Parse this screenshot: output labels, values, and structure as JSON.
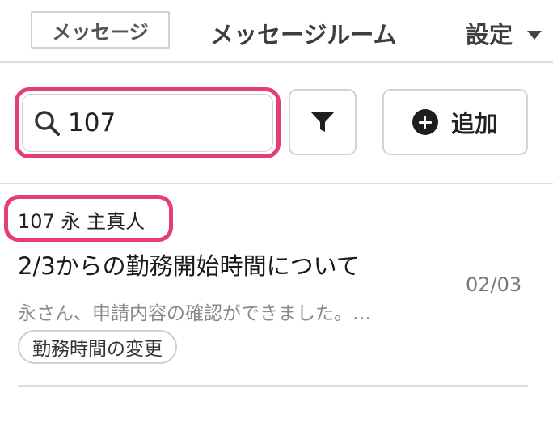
{
  "header": {
    "tab_label": "メッセージ",
    "title": "メッセージルーム",
    "settings_label": "設定"
  },
  "toolbar": {
    "search_value": "107",
    "add_label": "追加"
  },
  "messages": [
    {
      "header": "107 永 主真人",
      "subject": "2/3からの勤務開始時間について",
      "preview": "永さん、申請内容の確認ができました。…",
      "date": "02/03",
      "tag": "勤務時間の変更"
    }
  ],
  "colors": {
    "highlight": "#e43f74",
    "border": "#cfcfcf"
  }
}
